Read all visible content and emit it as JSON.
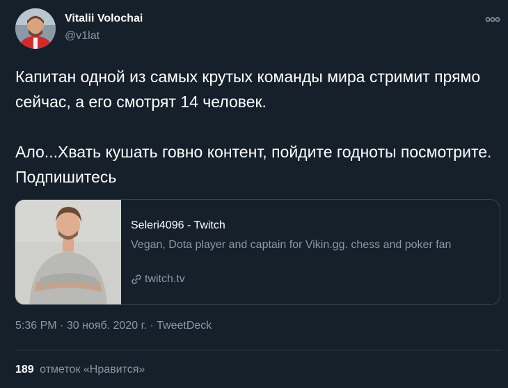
{
  "author": {
    "name": "Vitalii Volochai",
    "handle": "@v1lat"
  },
  "tweet": {
    "paragraphs": [
      "Капитан одной из самых крутых команды мира стримит прямо сейчас, а его смотрят 14 человек.",
      "Ало...Хвать кушать говно контент, пойдите годноты посмотрите. Подпишитесь"
    ]
  },
  "card": {
    "title": "Seleri4096 - Twitch",
    "description": "Vegan, Dota player and captain for Vikin.gg. chess and poker fan",
    "domain": "twitch.tv"
  },
  "meta": {
    "time": "5:36 PM",
    "separator": "·",
    "date": "30 нояб. 2020 г.",
    "source": "TweetDeck"
  },
  "likes": {
    "count": "189",
    "label": "отметок «Нравится»"
  },
  "colors": {
    "background": "#15202b",
    "text_primary": "#ffffff",
    "text_secondary": "#8899a6",
    "border": "#38444d"
  },
  "icons": {
    "more": "more-horizontal-icon",
    "link": "link-icon"
  }
}
